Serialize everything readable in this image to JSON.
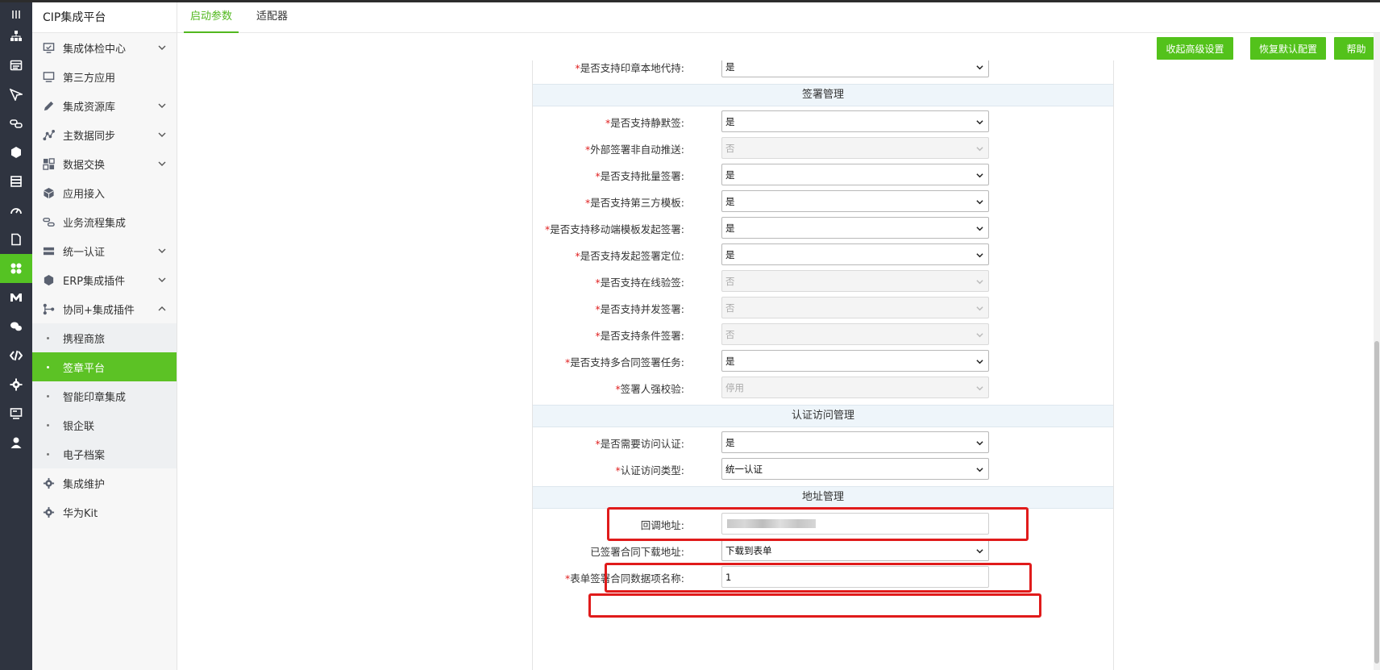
{
  "app": {
    "title": "CIP集成平台"
  },
  "colors": {
    "accent": "#53c21b",
    "required": "#e02020",
    "highlight_box": "#e01b1b",
    "rail_bg": "#2f3440"
  },
  "rail": {
    "icons": [
      "menu-lines-icon",
      "org-chart-icon",
      "table-icon",
      "paper-plane-icon",
      "link-chain-icon",
      "hexagon-icon",
      "layers-icon",
      "gauge-icon",
      "document-icon",
      "fan-icon",
      "m-logo-icon",
      "chat-icon",
      "code-icon",
      "gear-icon",
      "monitor-icon",
      "user-icon"
    ]
  },
  "sidebar": {
    "items": [
      {
        "label": "集成体检中心",
        "icon": "monitor-check-icon",
        "expandable": true
      },
      {
        "label": "第三方应用",
        "icon": "desktop-icon",
        "expandable": false
      },
      {
        "label": "集成资源库",
        "icon": "pen-icon",
        "expandable": true
      },
      {
        "label": "主数据同步",
        "icon": "graph-icon",
        "expandable": true
      },
      {
        "label": "数据交换",
        "icon": "exchange-icon",
        "expandable": true
      },
      {
        "label": "应用接入",
        "icon": "cube-icon",
        "expandable": false
      },
      {
        "label": "业务流程集成",
        "icon": "flow-icon",
        "expandable": false
      },
      {
        "label": "统一认证",
        "icon": "server-icon",
        "expandable": true
      },
      {
        "label": "ERP集成插件",
        "icon": "erp-icon",
        "expandable": true
      },
      {
        "label": "协同+集成插件",
        "icon": "share-icon",
        "expandable": true,
        "expanded": true
      }
    ],
    "subitems": [
      {
        "label": "携程商旅",
        "active": false
      },
      {
        "label": "签章平台",
        "active": true
      },
      {
        "label": "智能印章集成",
        "active": false
      },
      {
        "label": "银企联",
        "active": false
      },
      {
        "label": "电子档案",
        "active": false
      }
    ],
    "bottom_items": [
      {
        "label": "集成维护",
        "icon": "cog-icon"
      },
      {
        "label": "华为Kit",
        "icon": "cog-icon"
      }
    ]
  },
  "tabs": [
    {
      "label": "启动参数",
      "active": true
    },
    {
      "label": "适配器",
      "active": false
    }
  ],
  "toolbar": {
    "collapse_label": "收起高级设置",
    "restore_label": "恢复默认配置",
    "help_label": "帮助"
  },
  "form": {
    "top_field": {
      "label": "是否支持印章本地代持:",
      "value": "是",
      "required": true,
      "disabled": false
    },
    "sections": [
      {
        "title": "签署管理",
        "fields": [
          {
            "label": "是否支持静默签:",
            "value": "是",
            "required": true,
            "disabled": false
          },
          {
            "label": "外部签署非自动推送:",
            "value": "否",
            "required": true,
            "disabled": true
          },
          {
            "label": "是否支持批量签署:",
            "value": "是",
            "required": true,
            "disabled": false
          },
          {
            "label": "是否支持第三方模板:",
            "value": "是",
            "required": true,
            "disabled": false
          },
          {
            "label": "是否支持移动端模板发起签署:",
            "value": "是",
            "required": true,
            "disabled": false
          },
          {
            "label": "是否支持发起签署定位:",
            "value": "是",
            "required": true,
            "disabled": false
          },
          {
            "label": "是否支持在线验签:",
            "value": "否",
            "required": true,
            "disabled": true
          },
          {
            "label": "是否支持并发签署:",
            "value": "否",
            "required": true,
            "disabled": true
          },
          {
            "label": "是否支持条件签署:",
            "value": "否",
            "required": true,
            "disabled": true
          },
          {
            "label": "是否支持多合同签署任务:",
            "value": "是",
            "required": true,
            "disabled": false
          },
          {
            "label": "签署人强校验:",
            "value": "停用",
            "required": true,
            "disabled": true
          }
        ]
      },
      {
        "title": "认证访问管理",
        "fields": [
          {
            "label": "是否需要访问认证:",
            "value": "是",
            "required": true,
            "disabled": false
          },
          {
            "label": "认证访问类型:",
            "value": "统一认证",
            "required": true,
            "disabled": false
          }
        ]
      },
      {
        "title": "地址管理",
        "fields": [
          {
            "label": "回调地址:",
            "value": "",
            "required": false,
            "type": "text"
          },
          {
            "label": "已签署合同下载地址:",
            "value": "下载到表单",
            "required": false,
            "disabled": false
          },
          {
            "label": "表单签署合同数据项名称:",
            "value": "1",
            "required": true,
            "type": "text"
          }
        ]
      }
    ]
  }
}
